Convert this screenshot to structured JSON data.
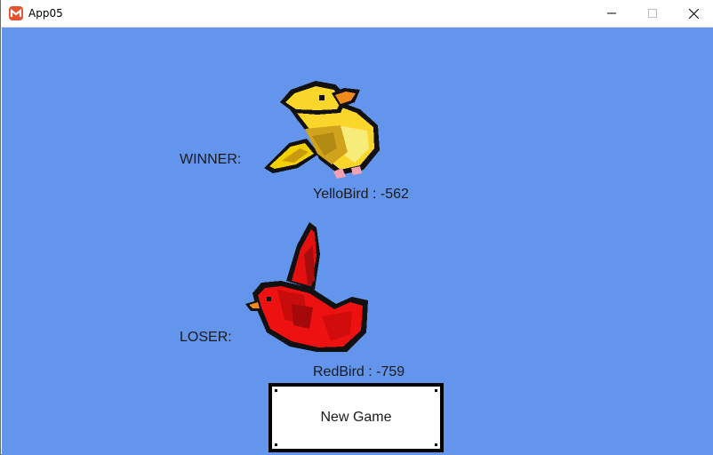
{
  "window": {
    "title": "App05"
  },
  "game": {
    "background_color": "#6495ed",
    "winner": {
      "label": "WINNER:",
      "score_text": "YelloBird : -562",
      "sprite": "yellow-bird"
    },
    "loser": {
      "label": "LOSER:",
      "score_text": "RedBird : -759",
      "sprite": "red-bird"
    },
    "new_game_label": "New Game"
  },
  "icons": {
    "app": "monogame-icon",
    "minimize": "minimize-icon",
    "maximize": "maximize-icon",
    "close": "close-icon"
  }
}
